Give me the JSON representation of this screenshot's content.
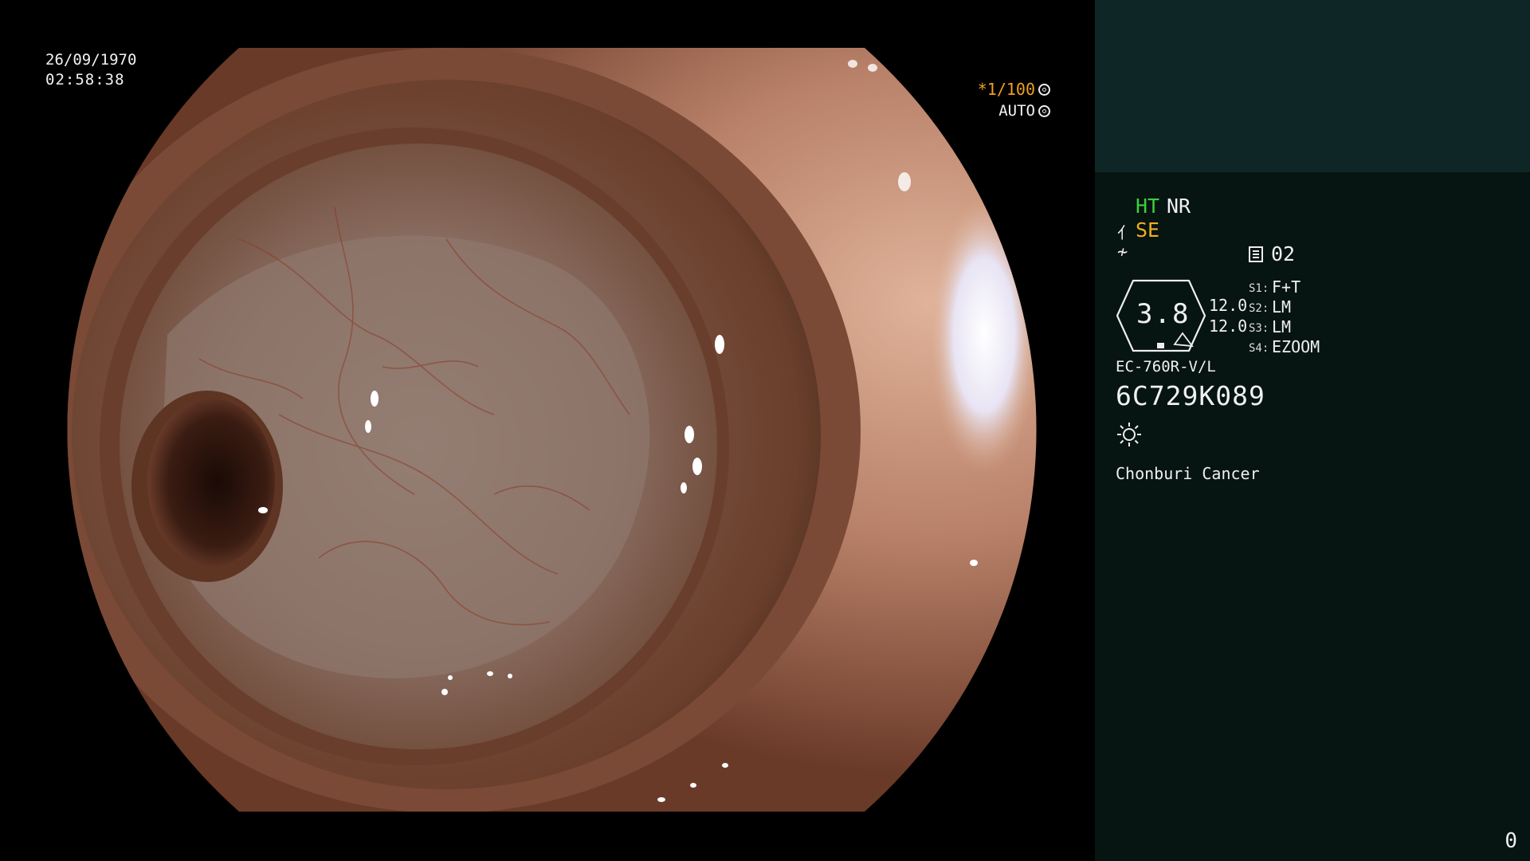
{
  "osd": {
    "date": "26/09/1970",
    "time": "02:58:38",
    "shutter": "*1/100",
    "iris": "AUTO"
  },
  "panel": {
    "ht": "HT",
    "nr": "NR",
    "se": "SE",
    "memory": "02",
    "zoom": "3.8",
    "aux1": "12.0",
    "aux2": "12.0",
    "switches": [
      {
        "label": "S1:",
        "value": "F+T"
      },
      {
        "label": "S2:",
        "value": "LM"
      },
      {
        "label": "S3:",
        "value": "LM"
      },
      {
        "label": "S4:",
        "value": "EZOOM"
      }
    ],
    "scope_model": "EC-760R-V/L",
    "scope_serial": "6C729K089",
    "hospital": "Chonburi Cancer",
    "counter": "0"
  },
  "icons": {
    "shutter": "shutter-aperture-icon",
    "iris": "iris-ring-icon",
    "se": "structure-enhance-icon",
    "curve": "gamma-curve-icon",
    "memory": "memory-card-icon",
    "light": "light-source-icon"
  },
  "colors": {
    "ht": "#3bd13b",
    "se": "#f0b020",
    "shutter": "#f0a020",
    "panel_bg": "#061412",
    "panel_top_bg": "#0e2626"
  }
}
